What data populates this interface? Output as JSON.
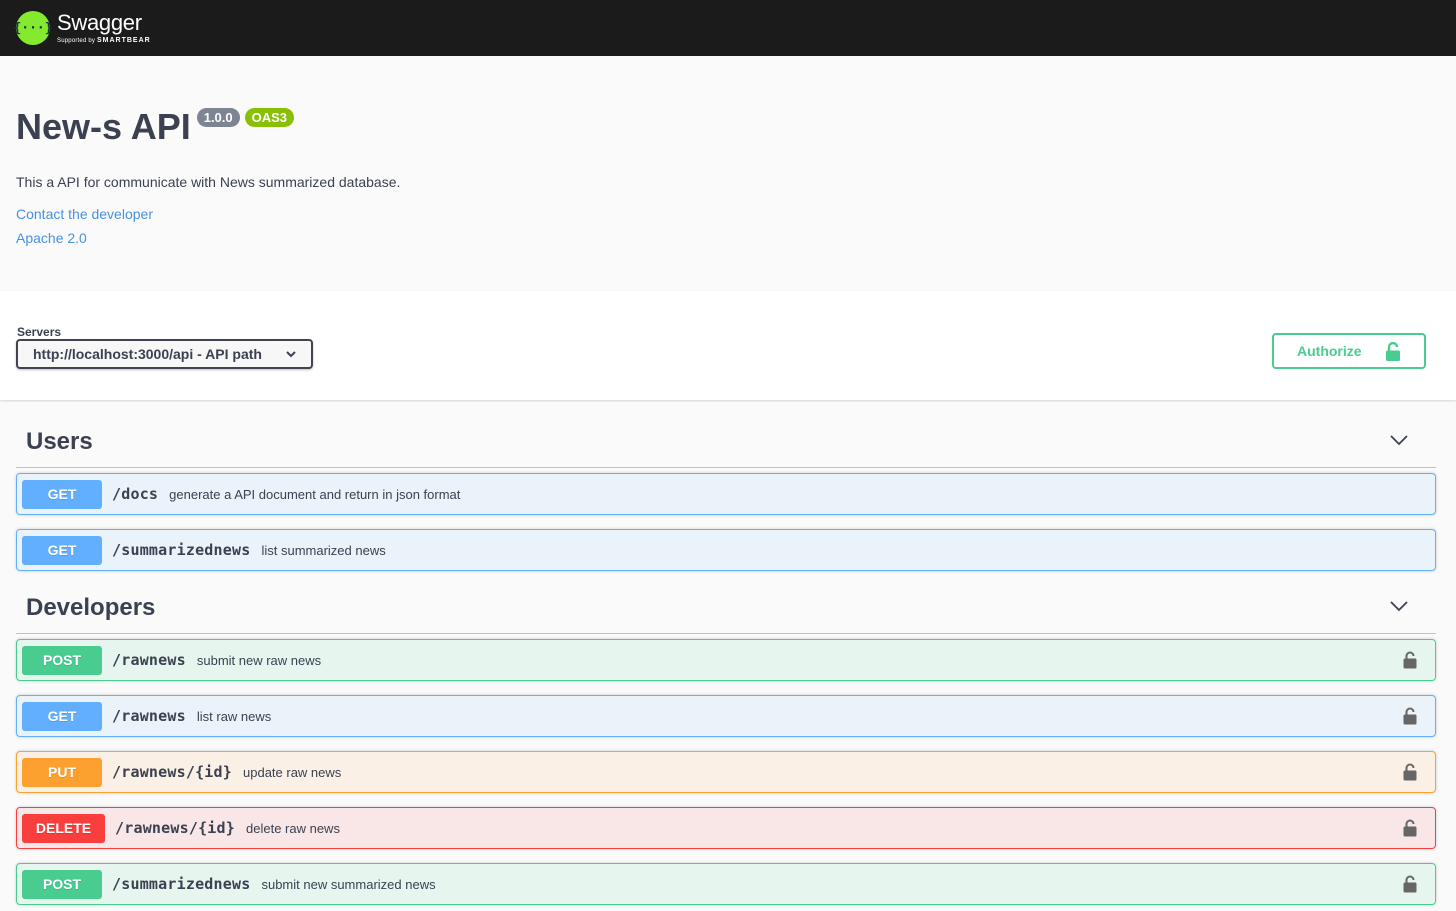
{
  "topbar": {
    "logo_name": "Swagger",
    "logo_sub_prefix": "Supported by",
    "logo_sub_brand": "SMARTBEAR",
    "logo_glyph": "{···}"
  },
  "info": {
    "title": "New-s API",
    "version": "1.0.0",
    "oas_badge": "OAS3",
    "description": "This a API for communicate with News summarized database.",
    "contact_link": "Contact the developer",
    "license_link": "Apache 2.0"
  },
  "servers": {
    "label": "Servers",
    "selected": "http://localhost:3000/api - API path"
  },
  "authorize": {
    "label": "Authorize",
    "icon": "unlock-icon"
  },
  "tags": [
    {
      "name": "Users",
      "operations": [
        {
          "method": "GET",
          "path": "/docs",
          "summary": "generate a API document and return in json format",
          "locked": false
        },
        {
          "method": "GET",
          "path": "/summarizednews",
          "summary": "list summarized news",
          "locked": false
        }
      ]
    },
    {
      "name": "Developers",
      "operations": [
        {
          "method": "POST",
          "path": "/rawnews",
          "summary": "submit new raw news",
          "locked": true
        },
        {
          "method": "GET",
          "path": "/rawnews",
          "summary": "list raw news",
          "locked": true
        },
        {
          "method": "PUT",
          "path": "/rawnews/{id}",
          "summary": "update raw news",
          "locked": true
        },
        {
          "method": "DELETE",
          "path": "/rawnews/{id}",
          "summary": "delete raw news",
          "locked": true
        },
        {
          "method": "POST",
          "path": "/summarizednews",
          "summary": "submit new summarized news",
          "locked": true
        }
      ]
    }
  ],
  "colors": {
    "get": "#61affe",
    "post": "#49cc90",
    "put": "#fca130",
    "delete": "#f93e3e",
    "link": "#4990e2",
    "topbar": "#1b1b1b",
    "logo": "#85ea2d"
  }
}
